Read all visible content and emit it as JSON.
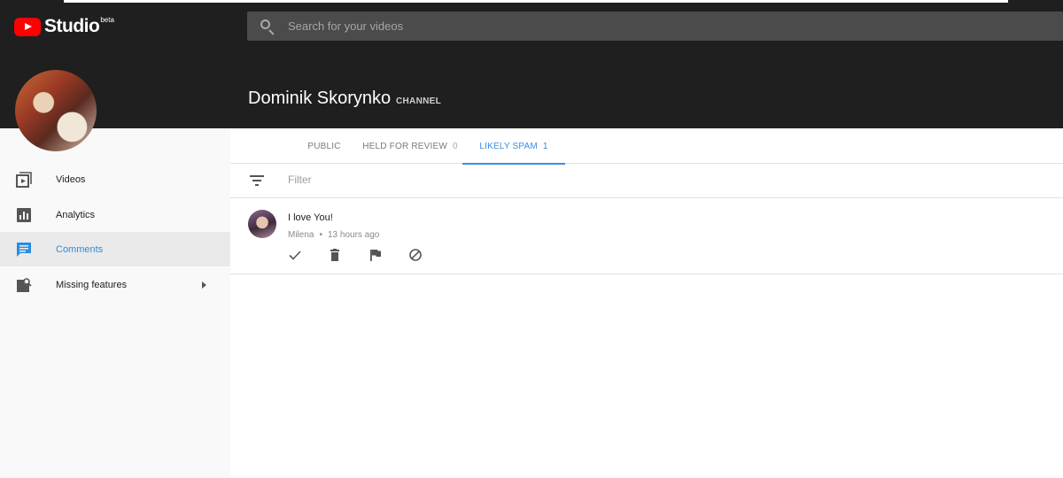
{
  "app": {
    "logo_text": "Studio",
    "logo_badge": "beta"
  },
  "search": {
    "placeholder": "Search for your videos"
  },
  "channel": {
    "name": "Dominik Skorynko",
    "tag": "CHANNEL"
  },
  "sidebar": {
    "items": [
      {
        "label": "Videos",
        "icon": "video-library-icon"
      },
      {
        "label": "Analytics",
        "icon": "analytics-icon"
      },
      {
        "label": "Comments",
        "icon": "comment-icon",
        "active": true
      },
      {
        "label": "Missing features",
        "icon": "missing-features-icon"
      }
    ]
  },
  "tabs": [
    {
      "label": "PUBLIC",
      "count": ""
    },
    {
      "label": "HELD FOR REVIEW",
      "count": "0"
    },
    {
      "label": "LIKELY SPAM",
      "count": "1",
      "active": true
    }
  ],
  "filter": {
    "placeholder": "Filter"
  },
  "comments": [
    {
      "text": "I love You!",
      "author": "Milena",
      "separator": "•",
      "time": "13 hours ago",
      "actions": [
        "approve-icon",
        "delete-icon",
        "flag-icon",
        "block-icon"
      ]
    }
  ],
  "colors": {
    "header_bg": "#1f1f1f",
    "accent": "#3a8ee0",
    "brand_red": "#ff0000"
  }
}
